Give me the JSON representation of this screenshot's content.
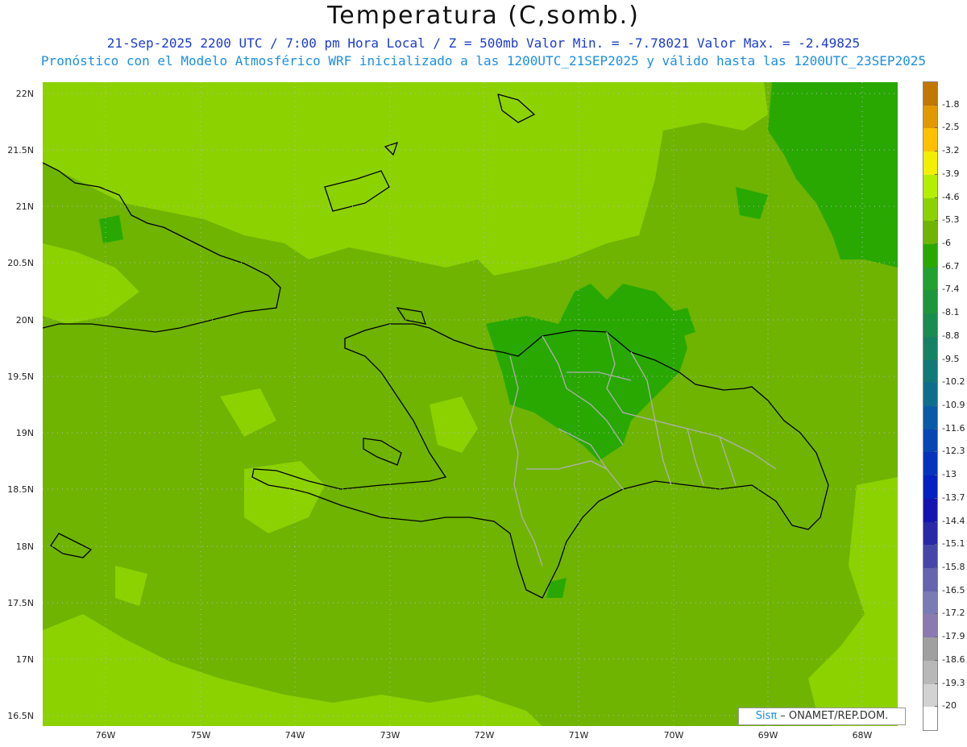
{
  "header": {
    "title": "Temperatura (C,somb.)",
    "subtitle1": "21-Sep-2025  2200 UTC / 7:00 pm Hora Local / Z = 500mb  Valor Min. = -7.78021  Valor Max. = -2.49825",
    "subtitle2": "Pronóstico con el Modelo Atmosférico WRF inicializado a las 1200UTC_21SEP2025 y válido hasta las  1200UTC_23SEP2025"
  },
  "lat_labels": [
    "22N",
    "21.5N",
    "21N",
    "20.5N",
    "20N",
    "19.5N",
    "19N",
    "18.5N",
    "18N",
    "17.5N",
    "17N",
    "16.5N"
  ],
  "lon_labels": [
    "76W",
    "75W",
    "74W",
    "73W",
    "72W",
    "71W",
    "70W",
    "69W",
    "68W"
  ],
  "colorbar": {
    "labels": [
      "-1.8",
      "-2.5",
      "-3.2",
      "-3.9",
      "-4.6",
      "-5.3",
      "-6",
      "-6.7",
      "-7.4",
      "-8.1",
      "-8.8",
      "-9.5",
      "-10.2",
      "-10.9",
      "-11.6",
      "-12.3",
      "-13",
      "-13.7",
      "-14.4",
      "-15.1",
      "-15.8",
      "-16.5",
      "-17.2",
      "-17.9",
      "-18.6",
      "-19.3",
      "-20"
    ],
    "colors": [
      "#c07800",
      "#e09a00",
      "#ffc000",
      "#f0f000",
      "#b4ee00",
      "#8cd200",
      "#6eb400",
      "#28a800",
      "#22a032",
      "#1e963c",
      "#1a8c50",
      "#168264",
      "#127878",
      "#0e6e8c",
      "#0a5aa8",
      "#0846b4",
      "#0632bc",
      "#0420c0",
      "#1414b0",
      "#2828a8",
      "#4646a8",
      "#6464b0",
      "#7a7ab4",
      "#8a7aae",
      "#a0a0a0",
      "#b8b8b8",
      "#d2d2d2",
      "#ffffff"
    ]
  },
  "map_colors": {
    "light": "#8cd200",
    "mid": "#6eb400",
    "dark": "#28a800"
  },
  "credit": {
    "sis": "Sisπ",
    "rest": " – ONAMET/REP.DOM."
  }
}
